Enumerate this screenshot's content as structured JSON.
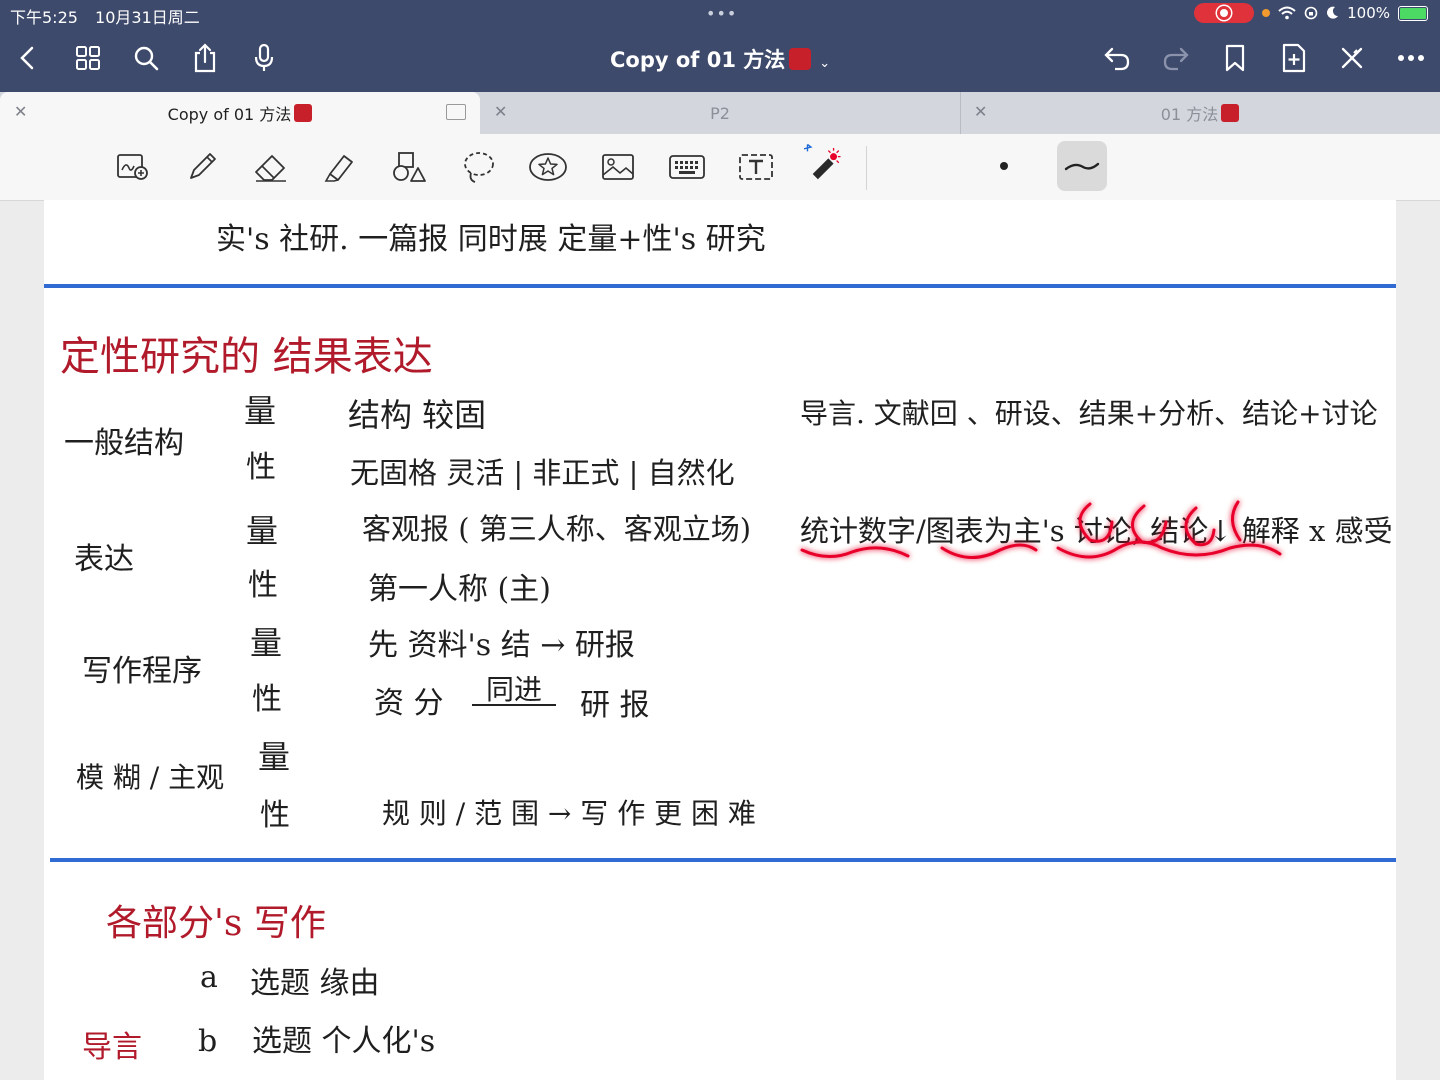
{
  "status": {
    "time": "下午5:25",
    "date": "10月31日周二",
    "dots": "•••",
    "battery": "100%"
  },
  "header": {
    "title": "Copy of 01 方法"
  },
  "tabs": [
    {
      "label": "Copy of 01 方法",
      "active": true
    },
    {
      "label": "P2",
      "active": false
    },
    {
      "label": "01 方法",
      "active": false
    }
  ],
  "notes": {
    "top_line": "实's 社研.  一篇报  同时展  定量+性's  研究",
    "section1_title": "定性研究的 结果表达",
    "rows": [
      {
        "label": "一般结构",
        "q_mark": "量",
        "q_text": "结构 较固",
        "x_mark": "性",
        "x_text": "无固格    灵活 | 非正式 | 自然化"
      },
      {
        "label": "表达",
        "q_mark": "量",
        "q_text": "客观报 ( 第三人称、客观立场)",
        "x_mark": "性",
        "x_text": "第一人称 (主)"
      },
      {
        "label": "写作程序",
        "q_mark": "量",
        "q_text": "先 资料's 结  →  研报",
        "x_mark": "性",
        "x_text": "资 分",
        "x_text_mid": "同进",
        "x_text_end": "研 报"
      },
      {
        "label": "模 糊 / 主观",
        "q_mark": "量",
        "q_text": "",
        "x_mark": "性",
        "x_text": "规 则 / 范 围  →  写 作  更 困 难"
      }
    ],
    "right_note1": "导言. 文献回 、研设、结果+分析、结论+讨论",
    "right_note2": "统计数字/图表为主's 讨论, 结论↓ 解释 x 感受",
    "section2_title": "各部分's 写作",
    "sub_label": "导言",
    "items": [
      {
        "marker": "a",
        "text": "选题  缘由"
      },
      {
        "marker": "b",
        "text": "选题  个人化's"
      }
    ]
  },
  "colors": {
    "header_bg": "#3e4a6b",
    "rule_blue": "#2f6bd2",
    "ink_red": "#b11a2a",
    "highlight": "#e8002a"
  }
}
